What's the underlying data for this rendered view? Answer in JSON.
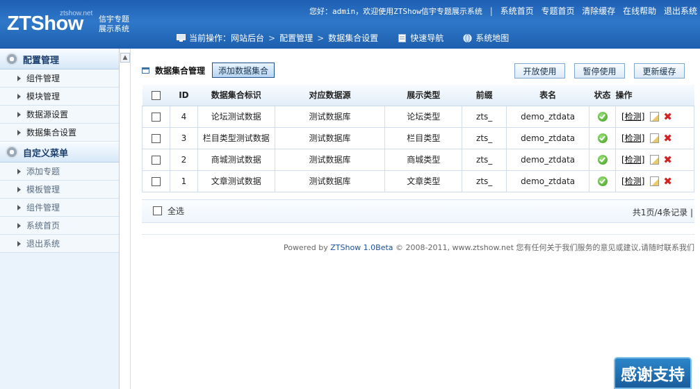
{
  "brand": {
    "logo": "ZTShow",
    "domain": "ztshow.net",
    "sub1": "信宇专题",
    "sub2": "展示系统"
  },
  "topbar": {
    "welcome": "您好：admin，欢迎使用ZTShow信宇专题展示系统",
    "sep": "|",
    "links": [
      "系统首页",
      "专题首页",
      "清除缓存",
      "在线帮助",
      "退出系统"
    ]
  },
  "navbar": {
    "current_label": "当前操作：",
    "breadcrumb": [
      "网站后台",
      "配置管理",
      "数据集合设置"
    ],
    "crumb_sep": ">",
    "quick_nav": "快速导航",
    "site_map": "系统地图"
  },
  "sidebar": {
    "sections": [
      {
        "title": "配置管理",
        "items": [
          "组件管理",
          "模块管理",
          "数据源设置",
          "数据集合设置"
        ]
      },
      {
        "title": "自定义菜单",
        "items": [
          "添加专题",
          "模板管理",
          "组件管理",
          "系统首页",
          "退出系统"
        ]
      }
    ]
  },
  "toolbar": {
    "title": "数据集合管理",
    "add_button": "添加数据集合",
    "enable_button": "开放使用",
    "pause_button": "暂停使用",
    "refresh_button": "更新缓存"
  },
  "table": {
    "headers": [
      "",
      "ID",
      "数据集合标识",
      "对应数据源",
      "展示类型",
      "前缀",
      "表名",
      "状态",
      "操作"
    ],
    "rows": [
      {
        "id": "4",
        "name": "论坛测试数据",
        "source": "测试数据库",
        "type": "论坛类型",
        "prefix": "zts_",
        "table": "demo_ztdata",
        "check": "[检测]"
      },
      {
        "id": "3",
        "name": "栏目类型测试数据",
        "source": "测试数据库",
        "type": "栏目类型",
        "prefix": "zts_",
        "table": "demo_ztdata",
        "check": "[检测]"
      },
      {
        "id": "2",
        "name": "商城测试数据",
        "source": "测试数据库",
        "type": "商城类型",
        "prefix": "zts_",
        "table": "demo_ztdata",
        "check": "[检测]"
      },
      {
        "id": "1",
        "name": "文章测试数据",
        "source": "测试数据库",
        "type": "文章类型",
        "prefix": "zts_",
        "table": "demo_ztdata",
        "check": "[检测]"
      }
    ]
  },
  "footer": {
    "select_all": "全选",
    "pager": "共1页/4条记录 |"
  },
  "powered": {
    "prefix": "Powered by ",
    "brand": "ZTShow 1.0Beta",
    "suffix": " © 2008-2011, www.ztshow.net 您有任何关于我们服务的意见或建议,请随时联系我们"
  },
  "thanks": "感谢支持",
  "colors": {
    "header": "#2f78c9",
    "sidebar_bg": "#eaf2fb",
    "status_ok": "#3a9a16",
    "delete": "#d42121"
  }
}
